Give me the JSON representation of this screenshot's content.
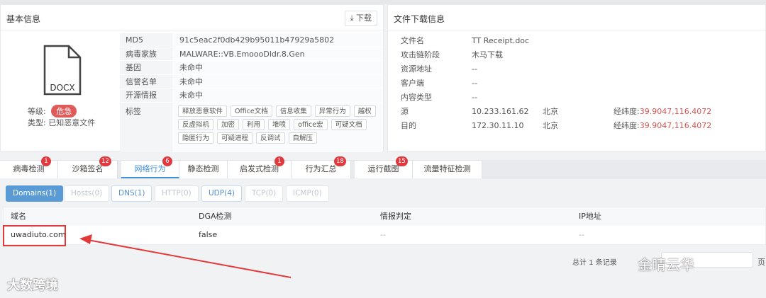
{
  "basic": {
    "title": "基本信息",
    "download_label": "下载",
    "file_type": "DOCX",
    "level_label": "等级:",
    "level_value": "危急",
    "type_label": "类型:",
    "type_value": "已知恶意文件",
    "rows": [
      {
        "label": "MD5",
        "value": "91c5eac2f0db429b95011b47929a5802"
      },
      {
        "label": "病毒家族",
        "value": "MALWARE::VB.EmoooDldr.8.Gen"
      },
      {
        "label": "基因",
        "value": "未命中"
      },
      {
        "label": "信誉名单",
        "value": "未命中"
      },
      {
        "label": "开源情报",
        "value": "未命中"
      }
    ],
    "tags_label": "标签",
    "tags": [
      "释放恶意软件",
      "Office文档",
      "信息收集",
      "异常行为",
      "越权",
      "反虚拟机",
      "加密",
      "利用",
      "堆喷",
      "office宏",
      "可疑文档",
      "隐匿行为",
      "可疑进程",
      "反调试",
      "自解压"
    ]
  },
  "download_info": {
    "title": "文件下载信息",
    "rows": [
      {
        "label": "文件名",
        "value": "TT Receipt.doc",
        "city": "",
        "geo_label": "",
        "geo_value": ""
      },
      {
        "label": "攻击链阶段",
        "value": "木马下载",
        "city": "",
        "geo_label": "",
        "geo_value": ""
      },
      {
        "label": "资源地址",
        "value": "--",
        "city": "",
        "geo_label": "",
        "geo_value": ""
      },
      {
        "label": "客户端",
        "value": "--",
        "city": "",
        "geo_label": "",
        "geo_value": ""
      },
      {
        "label": "内容类型",
        "value": "--",
        "city": "",
        "geo_label": "",
        "geo_value": ""
      },
      {
        "label": "源",
        "value": "10.233.161.62",
        "city": "北京",
        "geo_label": "经纬度:",
        "geo_value": "39.9047,116.4072"
      },
      {
        "label": "目的",
        "value": "172.30.11.10",
        "city": "北京",
        "geo_label": "经纬度:",
        "geo_value": "39.9047,116.4072"
      }
    ]
  },
  "tabs": [
    {
      "label": "病毒检测",
      "badge": "1"
    },
    {
      "label": "沙箱签名",
      "badge": "12"
    },
    {
      "label": "网络行为",
      "badge": "6"
    },
    {
      "label": "静态检测",
      "badge": ""
    },
    {
      "label": "启发式检测",
      "badge": "1"
    },
    {
      "label": "行为汇总",
      "badge": "18"
    },
    {
      "label": "运行截图",
      "badge": "15"
    },
    {
      "label": "流量特征检测",
      "badge": ""
    }
  ],
  "filters": [
    "Domains(1)",
    "Hosts(0)",
    "DNS(1)",
    "HTTP(0)",
    "UDP(4)",
    "TCP(0)",
    "ICMP(0)"
  ],
  "table": {
    "headers": [
      "域名",
      "DGA检测",
      "情报判定",
      "IP地址"
    ],
    "rows": [
      [
        "uwadiuto.com",
        "false",
        "--",
        "--"
      ]
    ]
  },
  "pager": {
    "total": "总计 1 条记录",
    "last": "页"
  },
  "watermarks": {
    "left": "大数跨境",
    "right": "金睛云华"
  },
  "colors": {
    "accent": "#3f8fd6",
    "danger": "#e0393e",
    "highlight": "#e23a3a"
  }
}
